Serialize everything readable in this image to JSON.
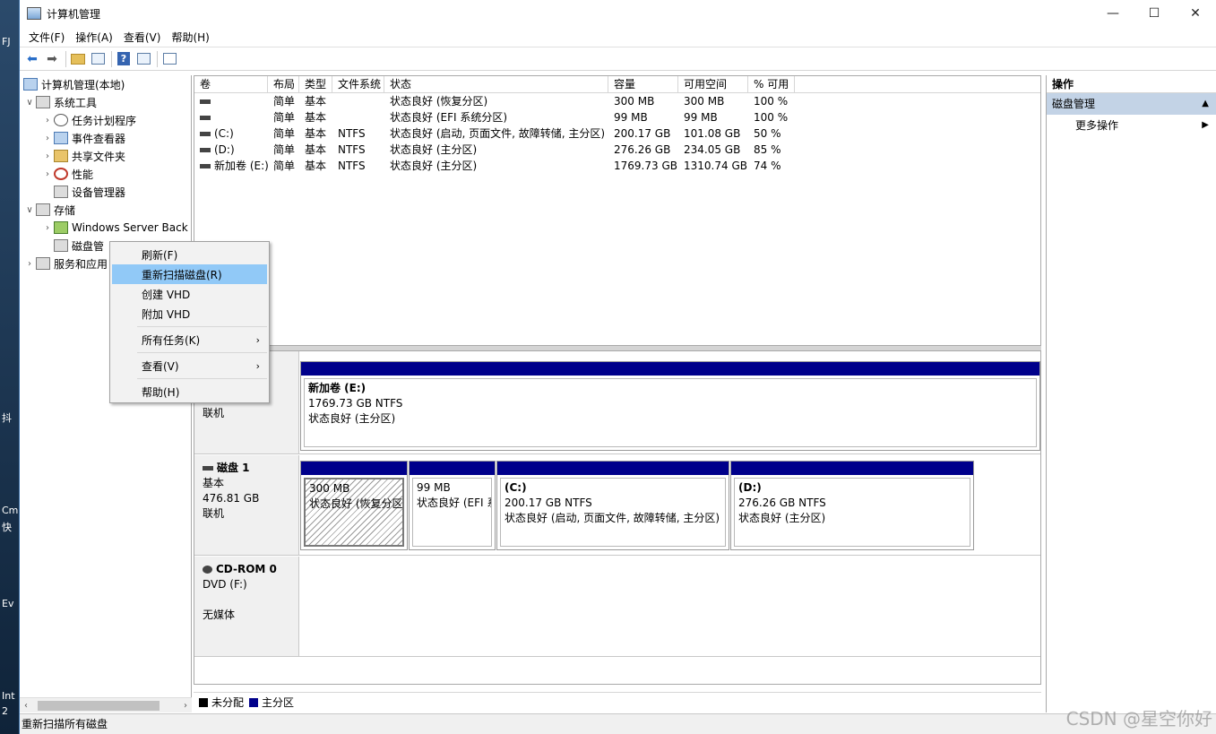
{
  "window": {
    "title": "计算机管理"
  },
  "desktop": {
    "labels": [
      "FJ",
      "抖",
      "Cm",
      "快",
      "Ev",
      "Int",
      "2"
    ]
  },
  "menubar": [
    "文件(F)",
    "操作(A)",
    "查看(V)",
    "帮助(H)"
  ],
  "tree": {
    "root": "计算机管理(本地)",
    "system_tools": "系统工具",
    "task_scheduler": "任务计划程序",
    "event_viewer": "事件查看器",
    "shared_folders": "共享文件夹",
    "performance": "性能",
    "device_manager": "设备管理器",
    "storage": "存储",
    "windows_server_backup": "Windows Server Back",
    "disk_management": "磁盘管",
    "services_apps": "服务和应用"
  },
  "context_menu": {
    "refresh": "刷新(F)",
    "rescan": "重新扫描磁盘(R)",
    "create_vhd": "创建 VHD",
    "attach_vhd": "附加 VHD",
    "all_tasks": "所有任务(K)",
    "view": "查看(V)",
    "help": "帮助(H)"
  },
  "volume_table": {
    "headers": [
      "卷",
      "布局",
      "类型",
      "文件系统",
      "状态",
      "容量",
      "可用空间",
      "% 可用"
    ],
    "rows": [
      [
        "",
        "简单",
        "基本",
        "",
        "状态良好 (恢复分区)",
        "300 MB",
        "300 MB",
        "100 %"
      ],
      [
        "",
        "简单",
        "基本",
        "",
        "状态良好 (EFI 系统分区)",
        "99 MB",
        "99 MB",
        "100 %"
      ],
      [
        "(C:)",
        "简单",
        "基本",
        "NTFS",
        "状态良好 (启动, 页面文件, 故障转储, 主分区)",
        "200.17 GB",
        "101.08 GB",
        "50 %"
      ],
      [
        "(D:)",
        "简单",
        "基本",
        "NTFS",
        "状态良好 (主分区)",
        "276.26 GB",
        "234.05 GB",
        "85 %"
      ],
      [
        "新加卷 (E:)",
        "简单",
        "基本",
        "NTFS",
        "状态良好 (主分区)",
        "1769.73 GB",
        "1310.74 GB",
        "74 %"
      ]
    ]
  },
  "disk0": {
    "size_partial": "1769.73 GB",
    "status": "联机",
    "part": {
      "name": "新加卷  (E:)",
      "size": "1769.73 GB NTFS",
      "status": "状态良好 (主分区)"
    }
  },
  "disk1": {
    "name": "磁盘 1",
    "type": "基本",
    "size": "476.81 GB",
    "status": "联机",
    "parts": [
      {
        "name": "",
        "size": "300 MB",
        "status": "状态良好 (恢复分区"
      },
      {
        "name": "",
        "size": "99 MB",
        "status": "状态良好 (EFI 系"
      },
      {
        "name": "(C:)",
        "size": "200.17 GB NTFS",
        "status": "状态良好 (启动, 页面文件, 故障转储, 主分区)"
      },
      {
        "name": "(D:)",
        "size": "276.26 GB NTFS",
        "status": "状态良好 (主分区)"
      }
    ]
  },
  "cdrom": {
    "name": "CD-ROM 0",
    "type": "DVD (F:)",
    "media": "无媒体"
  },
  "legend": {
    "unallocated": "未分配",
    "primary": "主分区",
    "unallocated_color": "#000000",
    "primary_color": "#00008b"
  },
  "actions": {
    "header": "操作",
    "section": "磁盘管理",
    "more": "更多操作"
  },
  "statusbar": {
    "text": "重新扫描所有磁盘"
  },
  "watermark": "CSDN @星空你好"
}
